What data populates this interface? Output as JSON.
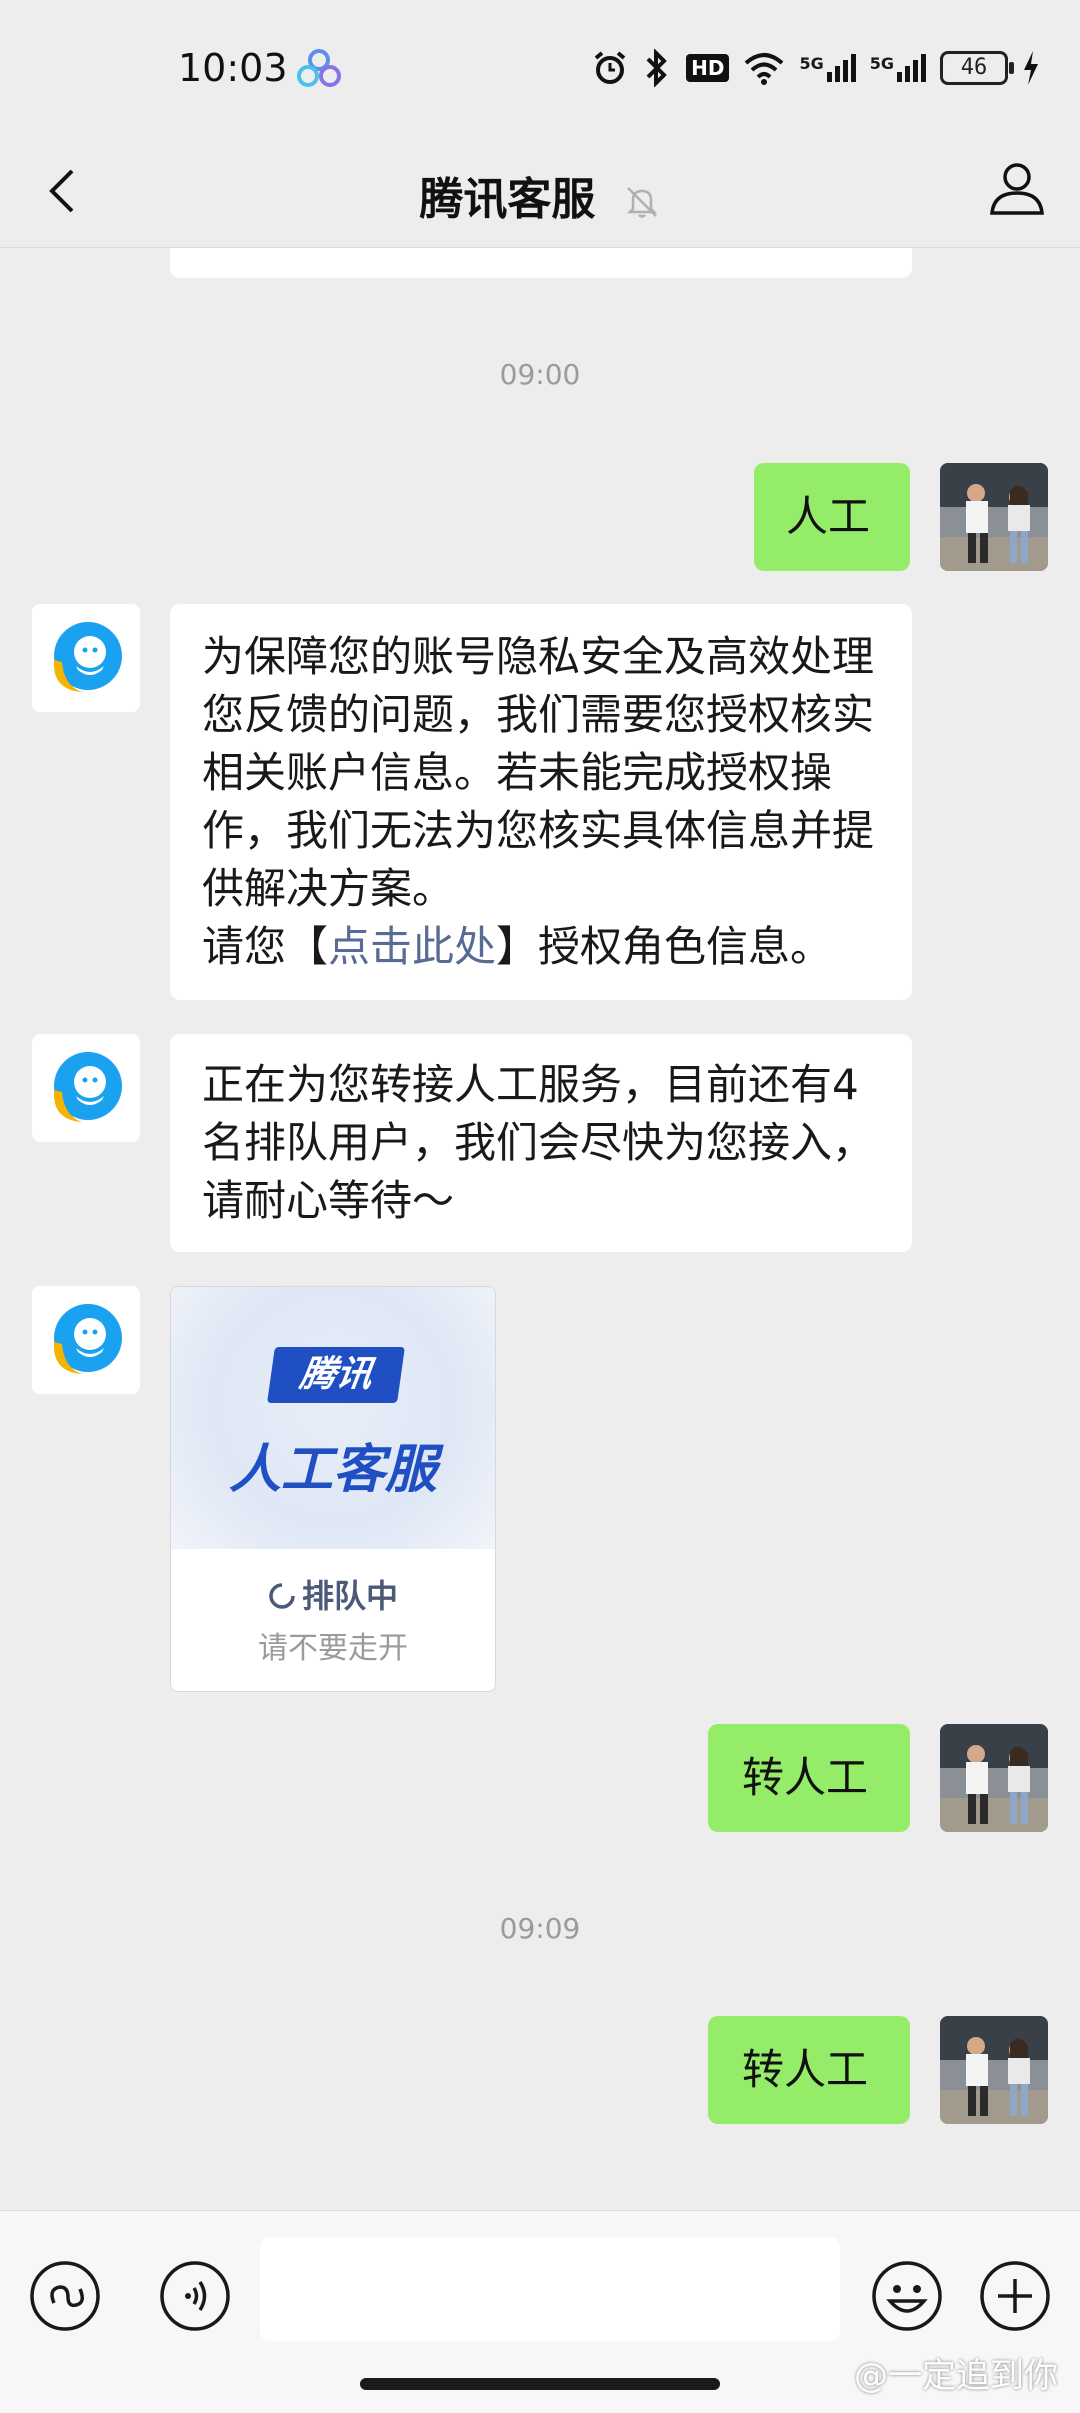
{
  "status_bar": {
    "time": "10:03",
    "battery": "46",
    "signal_1": "5G",
    "signal_2": "5G",
    "hd": "HD"
  },
  "header": {
    "title": "腾讯客服"
  },
  "messages": {
    "time_1": "09:00",
    "out_1": "人工",
    "in_1_line1": "为保障您的账号隐私安全及高效处理您反馈的问题，我们需要您授权核实相关账户信息。若未能完成授权操作，我们无法为您核实具体信息并提供解决方案。",
    "in_1_line2_prefix": "请您【",
    "in_1_link": "点击此处",
    "in_1_line2_suffix": "】授权角色信息。",
    "in_2": "正在为您转接人工服务，目前还有4名排队用户，我们会尽快为您接入，请耐心等待～",
    "card": {
      "tag": "腾讯",
      "title": "人工客服",
      "status": "排队中",
      "sub": "请不要走开"
    },
    "out_2": "转人工",
    "time_2": "09:09",
    "out_3": "转人工"
  },
  "watermark": "@一定追到你",
  "colors": {
    "background": "#ededed",
    "out_bubble": "#95ec69",
    "in_bubble": "#ffffff",
    "link": "#576b95",
    "card_brand": "#1f4fc2"
  }
}
